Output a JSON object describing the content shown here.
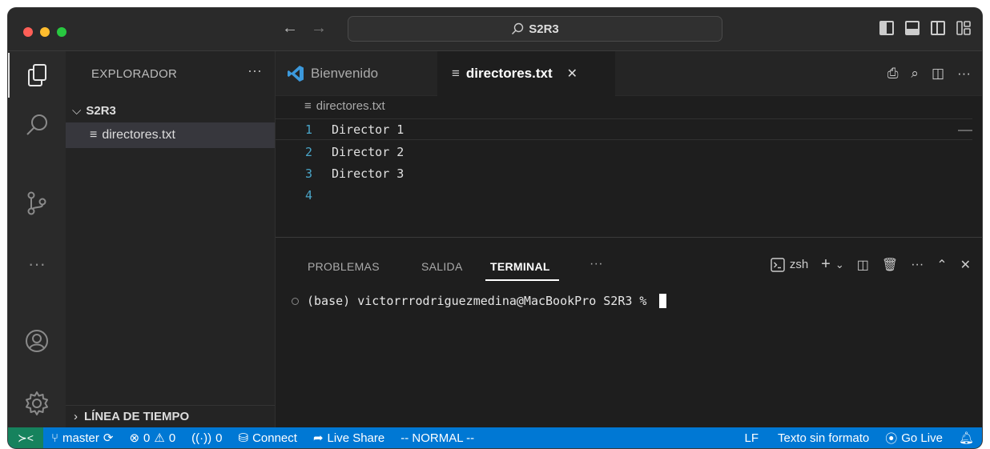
{
  "title": {
    "search": "S2R3"
  },
  "sidebar": {
    "title": "EXPLORADOR",
    "folder": "S2R3",
    "file": "directores.txt",
    "timeline": "LÍNEA DE TIEMPO"
  },
  "tabs": [
    {
      "label": "Bienvenido"
    },
    {
      "label": "directores.txt"
    }
  ],
  "breadcrumb": "directores.txt",
  "editor": {
    "lines": [
      {
        "num": "1",
        "text": "Director 1"
      },
      {
        "num": "2",
        "text": "Director 2"
      },
      {
        "num": "3",
        "text": "Director 3"
      },
      {
        "num": "4",
        "text": ""
      }
    ]
  },
  "panel": {
    "tabs": [
      "PROBLEMAS",
      "SALIDA",
      "TERMINAL"
    ],
    "shell": "zsh",
    "prompt": "(base) victorrrodriguezmedina@MacBookPro S2R3 %"
  },
  "status": {
    "branch": "master",
    "errors": "0",
    "warnings": "0",
    "ports": "0",
    "connect": "Connect",
    "live_share": "Live Share",
    "mode": "-- NORMAL --",
    "eol": "LF",
    "language": "Texto sin formato",
    "go_live": "Go Live"
  },
  "colors": {
    "statusbar": "#0078d4",
    "remote": "#16825d",
    "editor_bg": "#1e1e1e",
    "line_number": "#4aa5c8"
  }
}
